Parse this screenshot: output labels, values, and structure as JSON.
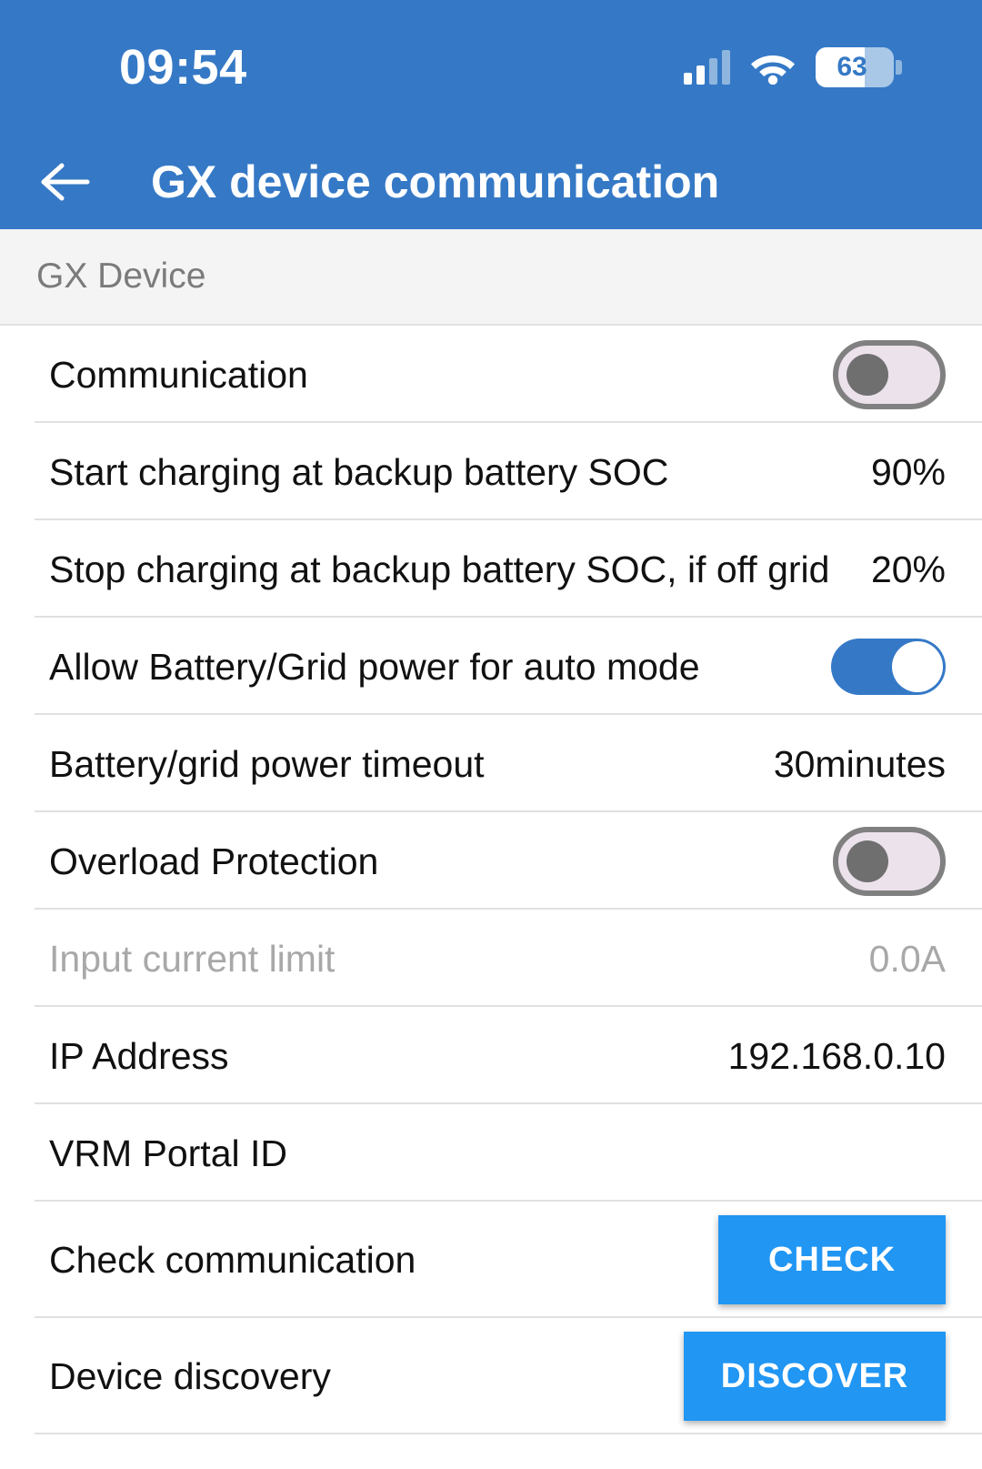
{
  "statusbar": {
    "time": "09:54",
    "battery_level": "63",
    "signal_icon": "signal-bars-icon",
    "wifi_icon": "wifi-icon",
    "battery_icon": "battery-icon"
  },
  "appbar": {
    "back_icon": "back-arrow-icon",
    "title": "GX device communication",
    "color": "#3579c6"
  },
  "section": {
    "header": "GX Device"
  },
  "rows": [
    {
      "label": "Communication",
      "type": "toggle",
      "state": "off"
    },
    {
      "label": "Start charging at backup battery SOC",
      "type": "value",
      "value": "90%"
    },
    {
      "label": "Stop charging at backup battery SOC, if off grid",
      "type": "value",
      "value": "20%"
    },
    {
      "label": "Allow Battery/Grid power for auto mode",
      "type": "toggle",
      "state": "on"
    },
    {
      "label": "Battery/grid power timeout",
      "type": "value",
      "value": "30minutes"
    },
    {
      "label": "Overload Protection",
      "type": "toggle",
      "state": "off"
    },
    {
      "label": "Input current limit",
      "type": "value",
      "value": "0.0A",
      "disabled": true
    },
    {
      "label": "IP Address",
      "type": "value",
      "value": "192.168.0.10"
    },
    {
      "label": "VRM Portal ID",
      "type": "value",
      "value": ""
    },
    {
      "label": "Check communication",
      "type": "button",
      "button_label": "CHECK"
    },
    {
      "label": "Device discovery",
      "type": "button",
      "button_label": "DISCOVER"
    }
  ],
  "colors": {
    "appbar_blue": "#3579c6",
    "button_blue": "#2196f3",
    "toggle_on": "#3579c6",
    "toggle_off_track": "#ece2ec",
    "section_bg": "#f4f4f4",
    "divider": "#e0e0e0",
    "disabled_text": "#a8a8a8"
  }
}
